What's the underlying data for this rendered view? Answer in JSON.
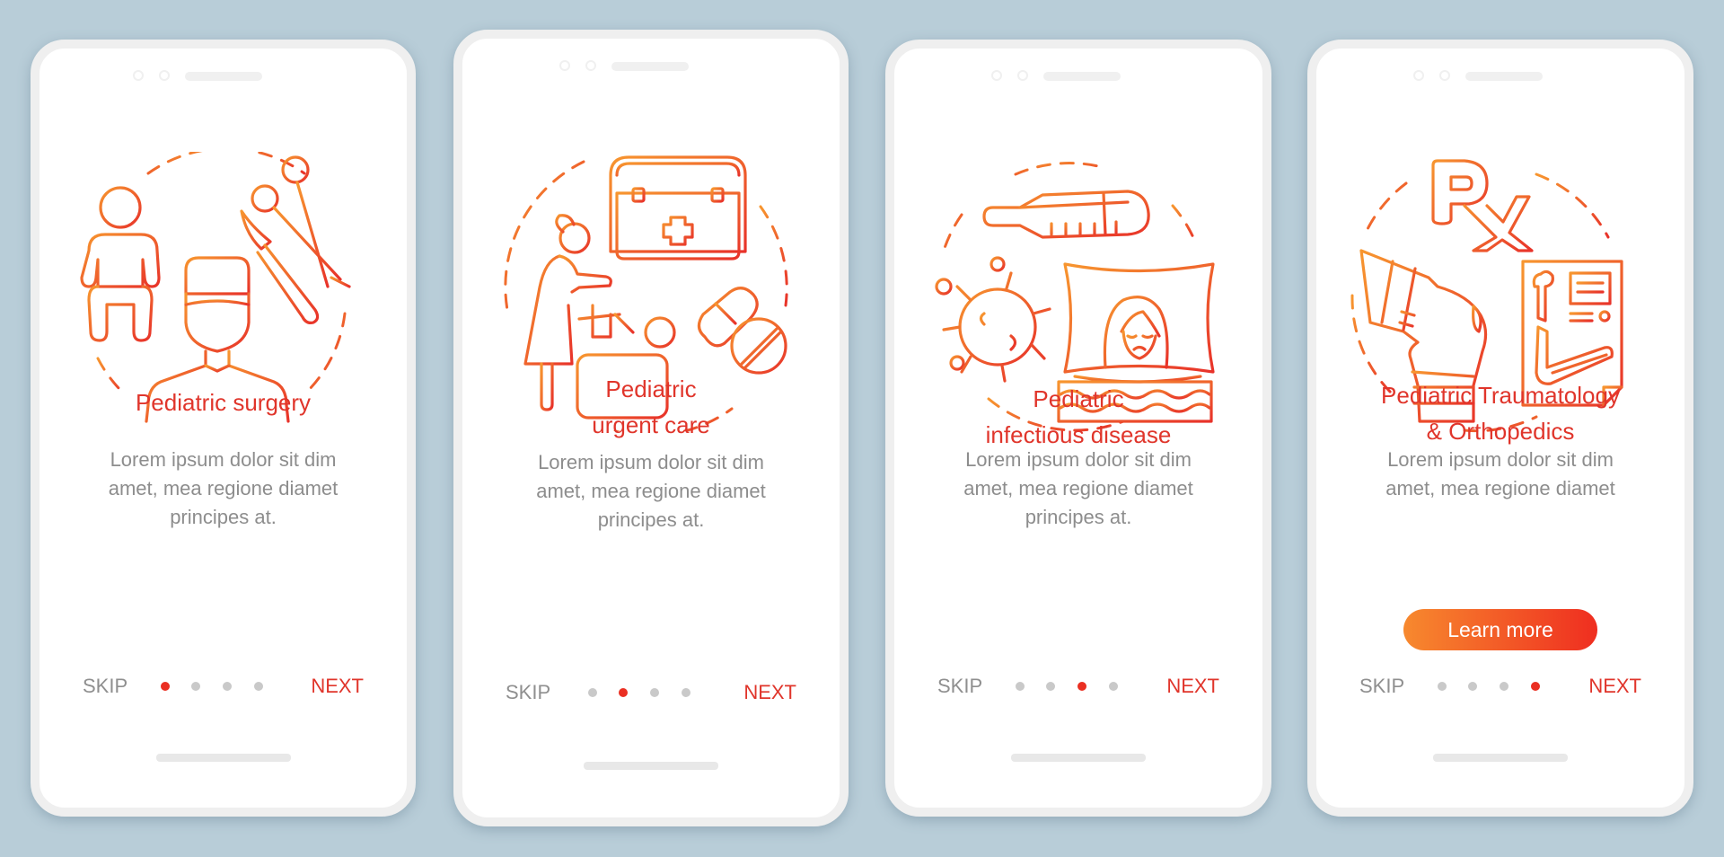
{
  "theme": {
    "background": "#b8cdd8",
    "accent": "#e0352b",
    "gradient_start": "#f7892e",
    "gradient_end": "#ef2e20",
    "inactive_dot": "#c9c9c9",
    "body_text": "#8d8d8d"
  },
  "screens": [
    {
      "title_lines": [
        "Pediatric surgery"
      ],
      "description_lines": [
        "Lorem ipsum dolor sit dim",
        "amet, mea regione diamet",
        "principes at."
      ],
      "illustration": "pediatric-surgery-icon",
      "active_page": 1,
      "nav": {
        "skip": "SKIP",
        "next": "NEXT"
      }
    },
    {
      "title_lines": [
        "Pediatric",
        "urgent care"
      ],
      "description_lines": [
        "Lorem ipsum dolor sit dim",
        "amet, mea regione diamet",
        "principes at."
      ],
      "illustration": "pediatric-urgent-care-icon",
      "active_page": 2,
      "nav": {
        "skip": "SKIP",
        "next": "NEXT"
      }
    },
    {
      "title_lines": [
        "Pediatric",
        "infectious disease"
      ],
      "description_lines": [
        "Lorem ipsum dolor sit dim",
        "amet, mea regione diamet",
        "principes at."
      ],
      "illustration": "pediatric-infectious-disease-icon",
      "active_page": 3,
      "nav": {
        "skip": "SKIP",
        "next": "NEXT"
      }
    },
    {
      "title_lines": [
        "Pediatric Traumatology",
        "& Orthopedics"
      ],
      "description_lines": [
        "Lorem ipsum dolor sit dim",
        "amet, mea regione diamet"
      ],
      "illustration": "pediatric-orthopedics-icon",
      "button": "Learn more",
      "active_page": 4,
      "nav": {
        "skip": "SKIP",
        "next": "NEXT"
      }
    }
  ],
  "total_pages": 4
}
